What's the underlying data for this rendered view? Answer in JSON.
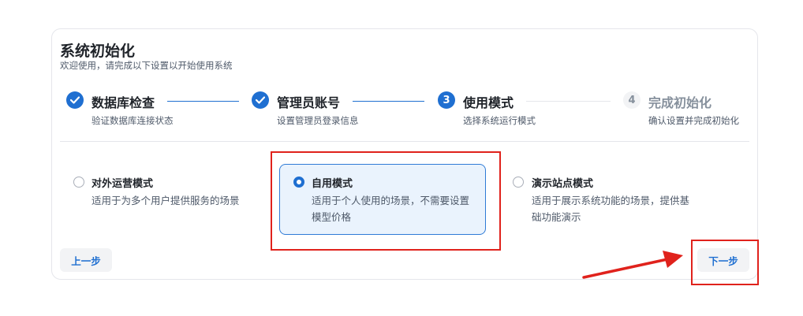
{
  "header": {
    "title": "系统初始化",
    "subtitle": "欢迎使用，请完成以下设置以开始使用系统"
  },
  "steps": [
    {
      "title": "数据库检查",
      "desc": "验证数据库连接状态",
      "status": "done",
      "number": "1"
    },
    {
      "title": "管理员账号",
      "desc": "设置管理员登录信息",
      "status": "done",
      "number": "2"
    },
    {
      "title": "使用模式",
      "desc": "选择系统运行模式",
      "status": "active",
      "number": "3"
    },
    {
      "title": "完成初始化",
      "desc": "确认设置并完成初始化",
      "status": "todo",
      "number": "4"
    }
  ],
  "options": [
    {
      "title": "对外运营模式",
      "desc": "适用于为多个用户提供服务的场景",
      "selected": false
    },
    {
      "title": "自用模式",
      "desc": "适用于个人使用的场景，不需要设置模型价格",
      "selected": true
    },
    {
      "title": "演示站点模式",
      "desc": "适用于展示系统功能的场景，提供基础功能演示",
      "selected": false
    }
  ],
  "buttons": {
    "prev": "上一步",
    "next": "下一步"
  },
  "colors": {
    "accent": "#1f6fd1",
    "annotation": "#e0221c",
    "selected_bg": "#eaf3fd"
  }
}
